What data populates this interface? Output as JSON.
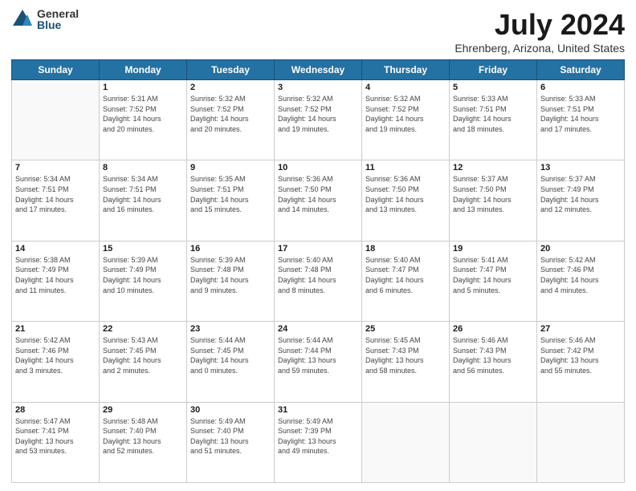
{
  "logo": {
    "general": "General",
    "blue": "Blue"
  },
  "header": {
    "title": "July 2024",
    "subtitle": "Ehrenberg, Arizona, United States"
  },
  "weekdays": [
    "Sunday",
    "Monday",
    "Tuesday",
    "Wednesday",
    "Thursday",
    "Friday",
    "Saturday"
  ],
  "weeks": [
    [
      {
        "day": "",
        "info": ""
      },
      {
        "day": "1",
        "info": "Sunrise: 5:31 AM\nSunset: 7:52 PM\nDaylight: 14 hours\nand 20 minutes."
      },
      {
        "day": "2",
        "info": "Sunrise: 5:32 AM\nSunset: 7:52 PM\nDaylight: 14 hours\nand 20 minutes."
      },
      {
        "day": "3",
        "info": "Sunrise: 5:32 AM\nSunset: 7:52 PM\nDaylight: 14 hours\nand 19 minutes."
      },
      {
        "day": "4",
        "info": "Sunrise: 5:32 AM\nSunset: 7:52 PM\nDaylight: 14 hours\nand 19 minutes."
      },
      {
        "day": "5",
        "info": "Sunrise: 5:33 AM\nSunset: 7:51 PM\nDaylight: 14 hours\nand 18 minutes."
      },
      {
        "day": "6",
        "info": "Sunrise: 5:33 AM\nSunset: 7:51 PM\nDaylight: 14 hours\nand 17 minutes."
      }
    ],
    [
      {
        "day": "7",
        "info": "Sunrise: 5:34 AM\nSunset: 7:51 PM\nDaylight: 14 hours\nand 17 minutes."
      },
      {
        "day": "8",
        "info": "Sunrise: 5:34 AM\nSunset: 7:51 PM\nDaylight: 14 hours\nand 16 minutes."
      },
      {
        "day": "9",
        "info": "Sunrise: 5:35 AM\nSunset: 7:51 PM\nDaylight: 14 hours\nand 15 minutes."
      },
      {
        "day": "10",
        "info": "Sunrise: 5:36 AM\nSunset: 7:50 PM\nDaylight: 14 hours\nand 14 minutes."
      },
      {
        "day": "11",
        "info": "Sunrise: 5:36 AM\nSunset: 7:50 PM\nDaylight: 14 hours\nand 13 minutes."
      },
      {
        "day": "12",
        "info": "Sunrise: 5:37 AM\nSunset: 7:50 PM\nDaylight: 14 hours\nand 13 minutes."
      },
      {
        "day": "13",
        "info": "Sunrise: 5:37 AM\nSunset: 7:49 PM\nDaylight: 14 hours\nand 12 minutes."
      }
    ],
    [
      {
        "day": "14",
        "info": "Sunrise: 5:38 AM\nSunset: 7:49 PM\nDaylight: 14 hours\nand 11 minutes."
      },
      {
        "day": "15",
        "info": "Sunrise: 5:39 AM\nSunset: 7:49 PM\nDaylight: 14 hours\nand 10 minutes."
      },
      {
        "day": "16",
        "info": "Sunrise: 5:39 AM\nSunset: 7:48 PM\nDaylight: 14 hours\nand 9 minutes."
      },
      {
        "day": "17",
        "info": "Sunrise: 5:40 AM\nSunset: 7:48 PM\nDaylight: 14 hours\nand 8 minutes."
      },
      {
        "day": "18",
        "info": "Sunrise: 5:40 AM\nSunset: 7:47 PM\nDaylight: 14 hours\nand 6 minutes."
      },
      {
        "day": "19",
        "info": "Sunrise: 5:41 AM\nSunset: 7:47 PM\nDaylight: 14 hours\nand 5 minutes."
      },
      {
        "day": "20",
        "info": "Sunrise: 5:42 AM\nSunset: 7:46 PM\nDaylight: 14 hours\nand 4 minutes."
      }
    ],
    [
      {
        "day": "21",
        "info": "Sunrise: 5:42 AM\nSunset: 7:46 PM\nDaylight: 14 hours\nand 3 minutes."
      },
      {
        "day": "22",
        "info": "Sunrise: 5:43 AM\nSunset: 7:45 PM\nDaylight: 14 hours\nand 2 minutes."
      },
      {
        "day": "23",
        "info": "Sunrise: 5:44 AM\nSunset: 7:45 PM\nDaylight: 14 hours\nand 0 minutes."
      },
      {
        "day": "24",
        "info": "Sunrise: 5:44 AM\nSunset: 7:44 PM\nDaylight: 13 hours\nand 59 minutes."
      },
      {
        "day": "25",
        "info": "Sunrise: 5:45 AM\nSunset: 7:43 PM\nDaylight: 13 hours\nand 58 minutes."
      },
      {
        "day": "26",
        "info": "Sunrise: 5:46 AM\nSunset: 7:43 PM\nDaylight: 13 hours\nand 56 minutes."
      },
      {
        "day": "27",
        "info": "Sunrise: 5:46 AM\nSunset: 7:42 PM\nDaylight: 13 hours\nand 55 minutes."
      }
    ],
    [
      {
        "day": "28",
        "info": "Sunrise: 5:47 AM\nSunset: 7:41 PM\nDaylight: 13 hours\nand 53 minutes."
      },
      {
        "day": "29",
        "info": "Sunrise: 5:48 AM\nSunset: 7:40 PM\nDaylight: 13 hours\nand 52 minutes."
      },
      {
        "day": "30",
        "info": "Sunrise: 5:49 AM\nSunset: 7:40 PM\nDaylight: 13 hours\nand 51 minutes."
      },
      {
        "day": "31",
        "info": "Sunrise: 5:49 AM\nSunset: 7:39 PM\nDaylight: 13 hours\nand 49 minutes."
      },
      {
        "day": "",
        "info": ""
      },
      {
        "day": "",
        "info": ""
      },
      {
        "day": "",
        "info": ""
      }
    ]
  ]
}
